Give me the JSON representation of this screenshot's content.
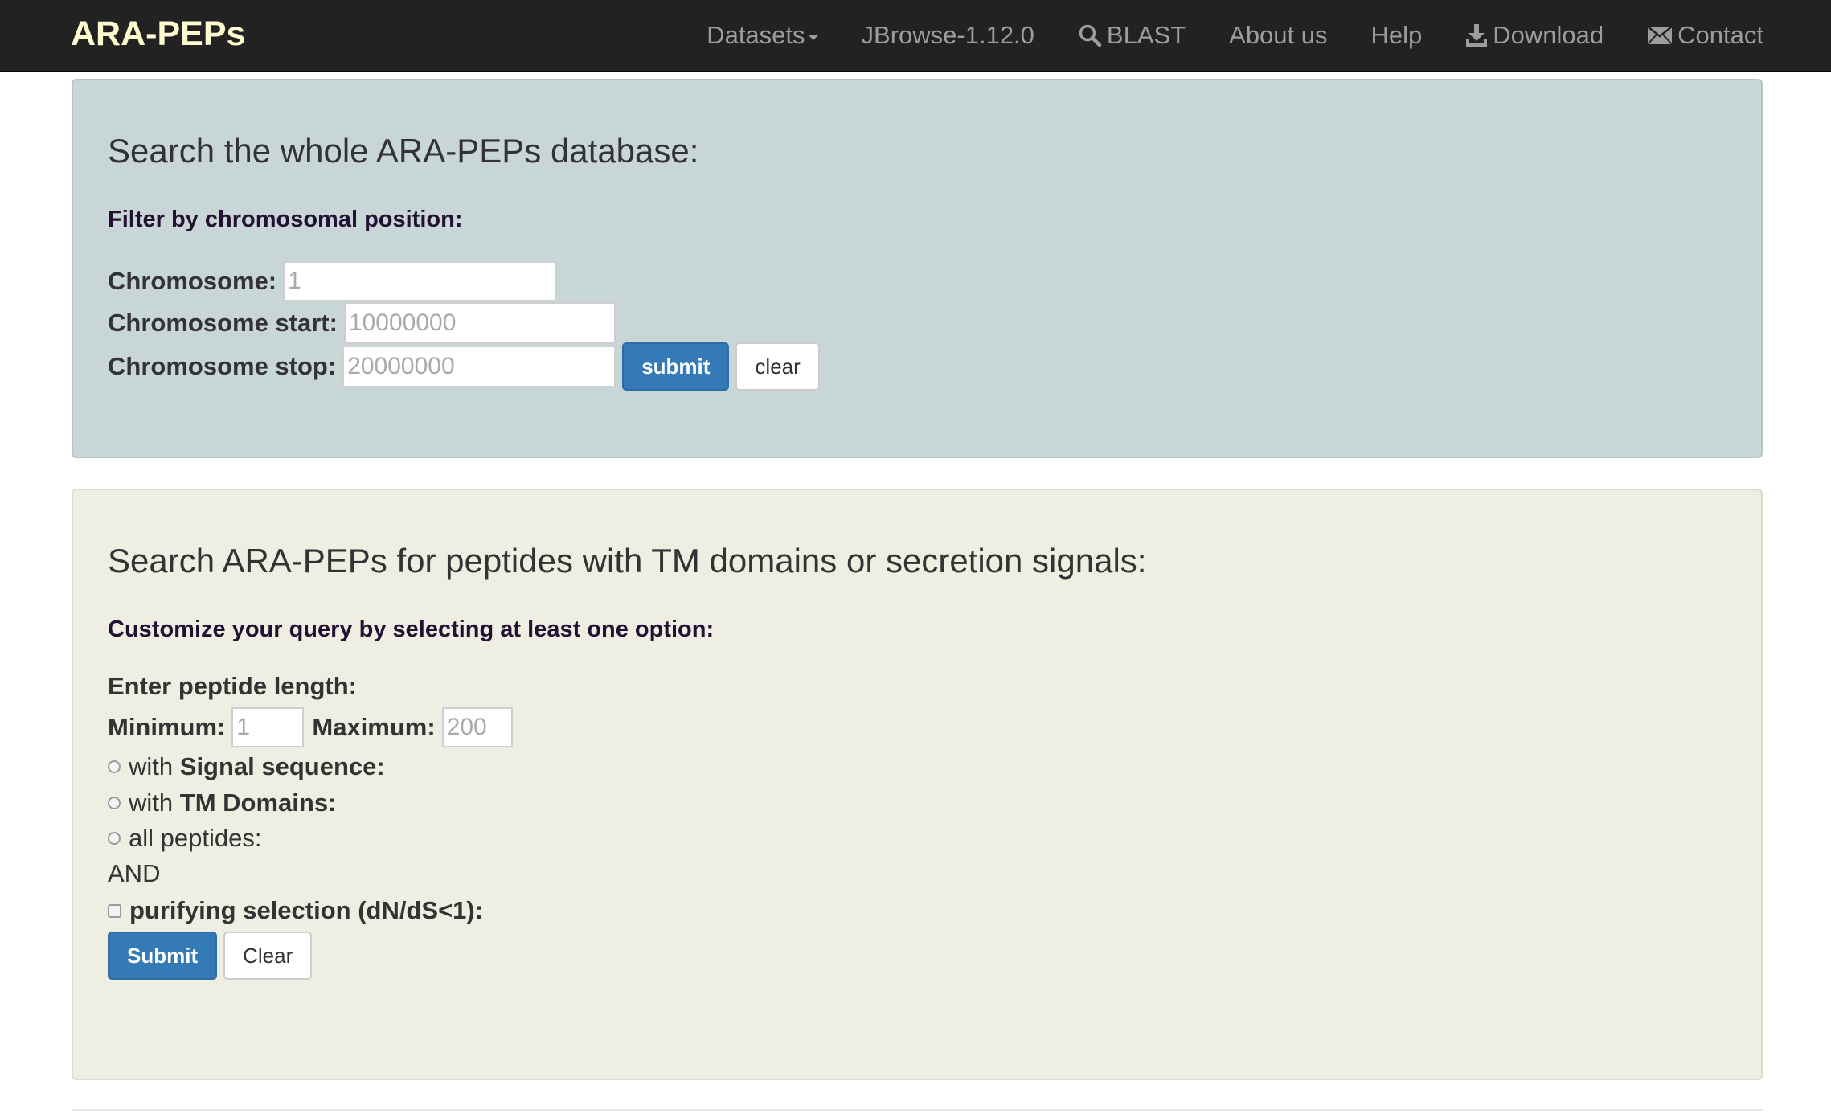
{
  "navbar": {
    "brand": "ARA-PEPs",
    "items": [
      {
        "label": "Datasets",
        "icon": "caret-down-icon"
      },
      {
        "label": "JBrowse-1.12.0"
      },
      {
        "label": "BLAST",
        "icon": "search-icon"
      },
      {
        "label": "About us"
      },
      {
        "label": "Help"
      },
      {
        "label": "Download",
        "icon": "download-icon"
      },
      {
        "label": "Contact",
        "icon": "envelope-icon"
      }
    ]
  },
  "panel1": {
    "title": "Search the whole ARA-PEPs database:",
    "subtitle": "Filter by chromosomal position:",
    "chromosome_label": "Chromosome:",
    "chromosome_placeholder": "1",
    "start_label": "Chromosome start:",
    "start_placeholder": "10000000",
    "stop_label": "Chromosome stop:",
    "stop_placeholder": "20000000",
    "submit_label": "submit",
    "clear_label": "clear"
  },
  "panel2": {
    "title": "Search ARA-PEPs for peptides with TM domains or secretion signals:",
    "subtitle": "Customize your query by selecting at least one option:",
    "length_label": "Enter peptide length:",
    "min_label": "Minimum:",
    "min_placeholder": "1",
    "max_label": "Maximum:",
    "max_placeholder": "200",
    "opt_signal_prefix": "with",
    "opt_signal_bold": "Signal sequence:",
    "opt_tm_prefix": "with",
    "opt_tm_bold": "TM Domains:",
    "opt_all": "all peptides:",
    "and_text": "AND",
    "purifying_label": "purifying selection (dN/dS<1):",
    "submit_label": "Submit",
    "clear_label": "Clear"
  },
  "colors": {
    "navbar_bg": "#222222",
    "brand": "#fffbd0",
    "panel1_bg": "#c9d6d7",
    "panel2_bg": "#efeee2",
    "primary": "#337ab7"
  }
}
